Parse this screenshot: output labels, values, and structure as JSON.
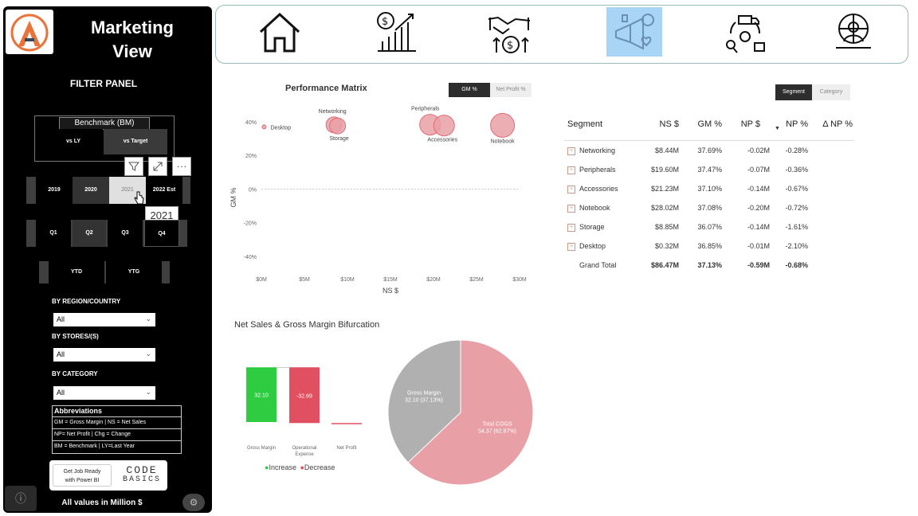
{
  "colors": {
    "accent_pink": "#e06c75",
    "pink_bubble": "#e8a0a6",
    "increase": "#2ecc40",
    "decrease": "#e05060",
    "gray": "#b0b0b0",
    "selected_nav": "#a8d4f5"
  },
  "sidebar": {
    "title_line1": "Marketing",
    "title_line2": "View",
    "filter_title": "FILTER PANEL",
    "benchmark": {
      "label": "Benchmark (BM)",
      "options": [
        "vs LY",
        "vs Target"
      ],
      "selected": "vs Target"
    },
    "tools": {
      "filter": "filter-icon",
      "focus": "focus-mode-icon",
      "more": "···"
    },
    "years": {
      "options": [
        "2019",
        "2020",
        "2021",
        "2022 Est"
      ],
      "selected": "2020",
      "hovered": "2021",
      "tooltip": "2021"
    },
    "quarters": {
      "options": [
        "Q1",
        "Q2",
        "Q3",
        "Q4"
      ],
      "selected": "Q2"
    },
    "ytd": {
      "options": [
        "YTD",
        "YTG"
      ]
    },
    "region": {
      "label": "BY REGION/COUNTRY",
      "value": "All"
    },
    "stores": {
      "label": "BY STORES/(S)",
      "value": "All"
    },
    "category": {
      "label": "BY CATEGORY",
      "value": "All"
    },
    "abbreviations": {
      "title": "Abbreviations",
      "lines": [
        "GM = Gross Margin | NS = Net Sales",
        "NP= Net Profit | Chg = Change",
        "BM = Benchmark | LY=Last Year"
      ]
    },
    "promo": {
      "line1": "Get Job Ready",
      "line2": "with Power BI",
      "brand1": "CODE",
      "brand2": "BASICS"
    },
    "footer": "All values in Million $"
  },
  "nav": {
    "items": [
      {
        "icon": "home-icon"
      },
      {
        "icon": "finance-growth-icon"
      },
      {
        "icon": "sales-handshake-icon"
      },
      {
        "icon": "marketing-icon",
        "selected": true
      },
      {
        "icon": "supply-chain-icon"
      },
      {
        "icon": "executive-globe-icon"
      }
    ]
  },
  "matrix": {
    "title": "Performance Matrix",
    "toggle": [
      "GM %",
      "Net Profit %"
    ],
    "toggle_selected": "GM %",
    "xlabel": "NS $",
    "ylabel": "GM %"
  },
  "bifurcation": {
    "title": "Net Sales & Gross Margin Bifurcation",
    "legend": [
      "Increase",
      "Decrease"
    ]
  },
  "table": {
    "toggle": [
      "Segment",
      "Category"
    ],
    "toggle_selected": "Segment",
    "headers": [
      "Segment",
      "NS $",
      "GM %",
      "NP $",
      "NP %",
      "Δ NP %"
    ],
    "rows": [
      [
        "Networking",
        "$8.44M",
        "37.69%",
        "-0.02M",
        "-0.28%"
      ],
      [
        "Peripherals",
        "$19.60M",
        "37.47%",
        "-0.07M",
        "-0.36%"
      ],
      [
        "Accessories",
        "$21.23M",
        "37.10%",
        "-0.14M",
        "-0.67%"
      ],
      [
        "Notebook",
        "$28.02M",
        "37.08%",
        "-0.20M",
        "-0.72%"
      ],
      [
        "Storage",
        "$8.85M",
        "36.07%",
        "-0.14M",
        "-1.61%"
      ],
      [
        "Desktop",
        "$0.32M",
        "36.85%",
        "-0.01M",
        "-2.10%"
      ]
    ],
    "total": [
      "Grand Total",
      "$86.47M",
      "37.13%",
      "-0.59M",
      "-0.68%"
    ]
  },
  "chart_data": [
    {
      "type": "scatter",
      "title": "Performance Matrix",
      "xlabel": "NS $",
      "ylabel": "GM %",
      "xlim": [
        0,
        30
      ],
      "ylim": [
        -50,
        40
      ],
      "x_ticks": [
        "$0M",
        "$5M",
        "$10M",
        "$15M",
        "$20M",
        "$25M",
        "$30M"
      ],
      "y_ticks": [
        "40%",
        "20%",
        "0%",
        "-20%",
        "-40%"
      ],
      "points": [
        {
          "label": "Desktop",
          "x": 0.32,
          "y": 37.0,
          "size": 1
        },
        {
          "label": "Networking",
          "x": 8.44,
          "y": 38.2,
          "size": 3
        },
        {
          "label": "Storage",
          "x": 8.85,
          "y": 37.6,
          "size": 3
        },
        {
          "label": "Peripherals",
          "x": 19.6,
          "y": 38.3,
          "size": 4
        },
        {
          "label": "Accessories",
          "x": 21.23,
          "y": 37.8,
          "size": 4
        },
        {
          "label": "Notebook",
          "x": 28.02,
          "y": 37.9,
          "size": 5
        }
      ]
    },
    {
      "type": "bar",
      "subtype": "waterfall",
      "categories": [
        "Gross Margin",
        "Operational Expense",
        "Net Profit"
      ],
      "values": [
        32.1,
        -32.69,
        -0.59
      ],
      "labels": [
        "32.10",
        "-32.69",
        ""
      ]
    },
    {
      "type": "pie",
      "slices": [
        {
          "label": "Gross Margin",
          "value": 32.1,
          "pct": "37.13%",
          "text": "32.10 (37.13%)"
        },
        {
          "label": "Total COGS",
          "value": 54.37,
          "pct": "62.87%",
          "text": "54.37 (62.87%)"
        }
      ]
    }
  ]
}
